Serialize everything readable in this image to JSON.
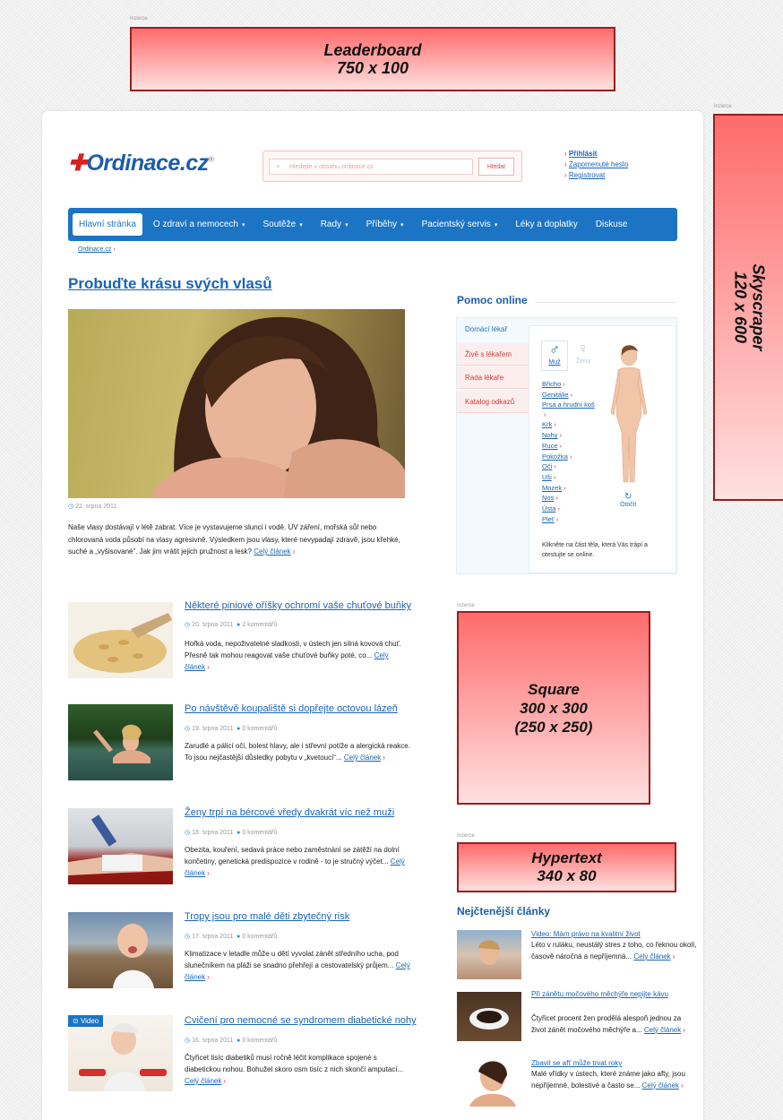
{
  "ads": {
    "label": "Inzerce",
    "leaderboard": {
      "line1": "Leaderboard",
      "line2": "750 x 100"
    },
    "skyscraper": {
      "line1": "Skyscraper",
      "line2": "120 x 600"
    },
    "square": {
      "line1": "Square",
      "line2": "300 x 300",
      "line3": "(250 x 250)"
    },
    "hypertext": {
      "line1": "Hypertext",
      "line2": "340 x 80"
    }
  },
  "header": {
    "logo_text": "Ordinace.cz",
    "logo_mark": "®",
    "search_placeholder": "Hledejte v obsahu ordinace.cz",
    "search_button": "Hledat",
    "links": [
      "Přihlásit",
      "Zapomenuté heslo",
      "Registrovat"
    ]
  },
  "nav": {
    "items": [
      "Hlavní stránka",
      "O zdraví a nemocech",
      "Soutěže",
      "Rady",
      "Příběhy",
      "Pacientský servis",
      "Léky a doplatky",
      "Diskuse"
    ],
    "caret": "▾"
  },
  "breadcrumb": {
    "label": "Ordinace.cz",
    "sep": "›"
  },
  "featured": {
    "title": "Probuďte krásu svých vlasů",
    "date": "22. srpna 2011",
    "text": "Naše vlasy dostávají v létě zabrat. Více je vystavujeme slunci i vodě. UV záření, mořská sůl nebo chlorovaná voda působí na vlasy agresivně. Výsledkem jsou vlasy, které nevypadají zdravě, jsou křehké, suché a „vyšisované“. Jak jim vrátit jejich pružnost a lesk?",
    "more": "Celý článek"
  },
  "articles": [
    {
      "title": "Některé piniové oříšky ochromí vaše chuťové buňky",
      "date": "20. srpna 2011",
      "comments": "2 komentářů",
      "text": "Hořká voda, nepoživatelné sladkosti, v ústech jen silná kovová chuť. Přesně tak mohou reagovat vaše chuťové buňky poté, co...",
      "more": "Celý článek"
    },
    {
      "title": "Po návštěvě koupaliště si dopřejte octovou lázeň",
      "date": "19. srpna 2011",
      "comments": "0 komentářů",
      "text": "Zarudlé a pálicí oči, bolest hlavy, ale i střevní potíže a alergická reakce. To jsou nejčastější důsledky pobytu v „kvetoucí“...",
      "more": "Celý článek"
    },
    {
      "title": "Ženy trpí na bércové vředy dvakrát víc než muži",
      "date": "18. srpna 2011",
      "comments": "0 komentářů",
      "text": "Obezita, kouření, sedavá práce nebo zaměstnání se zátěží na dolní končetiny, genetická predispozice v rodině - to je stručný výčet...",
      "more": "Celý článek"
    },
    {
      "title": "Tropy jsou pro malé děti zbytečný risk",
      "date": "17. srpna 2011",
      "comments": "0 komentářů",
      "text": "Klimatizace v letadle může u dětí vyvolat zánět středního ucha, pod slunečníkem na pláži se snadno přehřejí a cestovatelský průjem...",
      "more": "Celý článek"
    },
    {
      "title": "Cvičení pro nemocné se syndromem diabetické nohy",
      "date": "16. srpna 2011",
      "comments": "0 komentářů",
      "text": "Čtyřicet tisíc diabetiků musí ročně léčit komplikace spojené s diabetickou nohou. Bohužel skoro osm tisíc z nich skončí amputací...",
      "more": "Celý článek",
      "badge": "Video"
    }
  ],
  "help": {
    "title": "Pomoc online",
    "tabs": [
      "Domácí lékař",
      "Živě s lékařem",
      "Rada lékaře",
      "Katalog odkazů"
    ],
    "gender_male": "Muž",
    "gender_female": "Žena",
    "body_parts": [
      "Břicho",
      "Genitálie",
      "Prsa a hrudní koš",
      "Krk",
      "Nohy",
      "Ruce",
      "Pokožka",
      "Oči",
      "Uši",
      "Mozek",
      "Nos",
      "Ústa",
      "Pleť"
    ],
    "rotate": "Otočit",
    "hint": "Klikněte na část těla, která Vás trápí a otestujte se online."
  },
  "popular": {
    "title": "Nejčtenější články",
    "items": [
      {
        "title": "Video: Mám právo na kvalitní život",
        "text": "Léto v ruláku, neustálý stres z toho, co řeknou okolí, časově náročná a nepříjemná...",
        "more": "Celý článek"
      },
      {
        "title": "Při zánětu močového měchýře nepijte kávu",
        "text": "Čtyřicet procent žen prodělá alespoň jednou za život zánět močového měchýře a...",
        "more": "Celý článek"
      },
      {
        "title": "Zbavit se afť může trvat roky",
        "text": "Malé vřídky v ústech, které známe jako afty, jsou nepříjemné, bolestivé a často se...",
        "more": "Celý článek"
      }
    ]
  },
  "colors": {
    "brand_blue": "#1b74c4",
    "ad_red": "#ff6b6b",
    "link_red": "#d22222"
  }
}
